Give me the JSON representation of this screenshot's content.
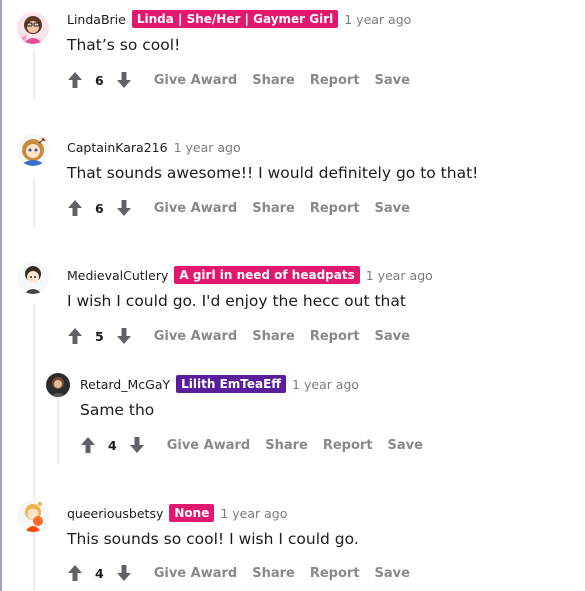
{
  "colors": {
    "flair_pink": "#e2186f",
    "flair_purple": "#5a1e9c",
    "thread_rule": "#a39ecb",
    "action_gray": "#878a8c",
    "icon_gray": "#5f6368"
  },
  "actions": {
    "give_award": "Give Award",
    "share": "Share",
    "report": "Report",
    "save": "Save"
  },
  "comments": [
    {
      "username": "LindaBrie",
      "flair": "Linda | She/Her | Gaymer Girl",
      "time": "1 year ago",
      "body": "That’s so cool!",
      "votes": "6"
    },
    {
      "username": "CaptainKara216",
      "flair": "",
      "time": "1 year ago",
      "body": "That sounds awesome!! I would definitely go to that!",
      "votes": "6"
    },
    {
      "username": "MedievalCutlery",
      "flair": "A girl in need of headpats",
      "time": "1 year ago",
      "body": "I wish I could go. I'd enjoy the hecc out that",
      "votes": "5"
    },
    {
      "username": "Retard_McGaY",
      "flair": "Lilith EmTeaEff",
      "time": "1 year ago",
      "body": "Same tho",
      "votes": "4"
    },
    {
      "username": "queeriousbetsy",
      "flair": "None",
      "time": "1 year ago",
      "body": "This sounds so cool! I wish I could go.",
      "votes": "4"
    }
  ]
}
